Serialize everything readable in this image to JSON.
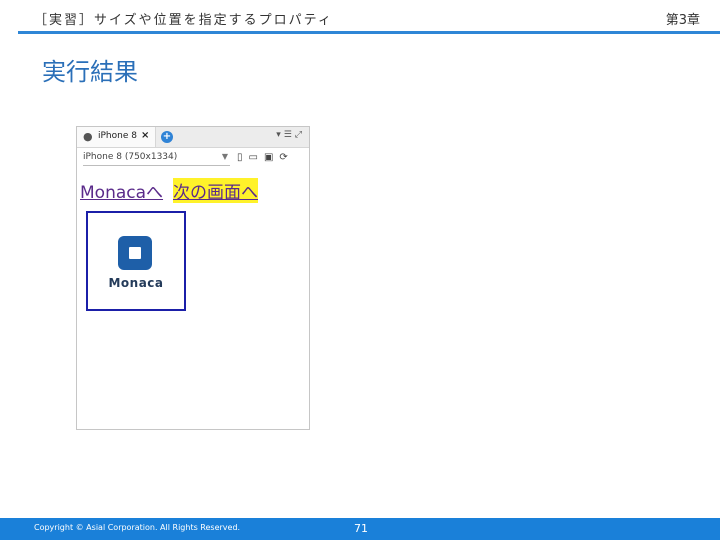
{
  "header": {
    "title": "［実習］サイズや位置を指定するプロパティ",
    "chapter": "第3章"
  },
  "section_title": "実行結果",
  "simulator": {
    "tab_label": "iPhone 8",
    "tab_close": "×",
    "add_tab": "+",
    "toolbar_icons": "▾☰⤢",
    "device_select": "iPhone 8 (750x1334)",
    "device_icons": "▯▭▣⟳",
    "viewport": {
      "link1": "Monacaへ",
      "link2": "次の画面へ",
      "logo_text": "Monaca"
    }
  },
  "footer": {
    "copyright": "Copyright © Asial Corporation. All Rights Reserved.",
    "page_number": "71"
  },
  "colors": {
    "accent": "#2e86d6",
    "footer": "#1a80d9",
    "link": "#5a2a8a",
    "highlight": "#fff22a",
    "logo_border": "#1b1fa8",
    "logo_mark": "#1e5fa8"
  }
}
